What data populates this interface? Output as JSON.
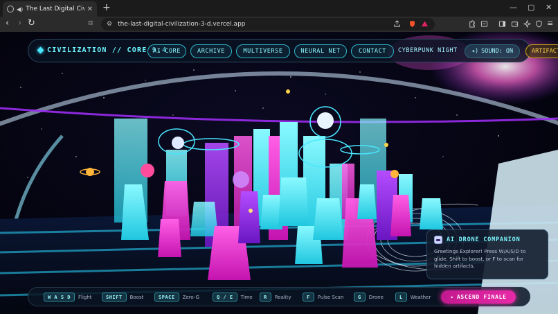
{
  "browser": {
    "tab_title": "The Last Digital Civilization",
    "url": "the-last-digital-civilization-3-d.vercel.app",
    "new_tab_label": "+"
  },
  "hud": {
    "brand": "CIVILIZATION // CORE 9.4",
    "nav": [
      "AI CORE",
      "ARCHIVE",
      "MULTIVERSE",
      "NEURAL NET",
      "CONTACT"
    ],
    "theme": "CYBERPUNK NIGHT",
    "sound": "SOUND: ON",
    "artifacts": "ARTIFACTS"
  },
  "companion": {
    "title": "AI DRONE COMPANION",
    "message": "Greetings Explorer! Press W/A/S/D to glide, Shift to boost, or F to scan for hidden artifacts."
  },
  "controls": [
    {
      "key": "W A S D",
      "label": "Flight"
    },
    {
      "key": "SHIFT",
      "label": "Boost"
    },
    {
      "key": "SPACE",
      "label": "Zero-G"
    },
    {
      "key": "Q / E",
      "label": "Time"
    },
    {
      "key": "R",
      "label": "Reality"
    },
    {
      "key": "F",
      "label": "Pulse Scan"
    },
    {
      "key": "G",
      "label": "Drone"
    },
    {
      "key": "L",
      "label": "Weather"
    }
  ],
  "finale": "ASCEND FINALE",
  "colors": {
    "cyan": "#49e7ff",
    "magenta": "#e82aa8",
    "violet": "#9a2cf0",
    "gold": "#ffd24a"
  }
}
